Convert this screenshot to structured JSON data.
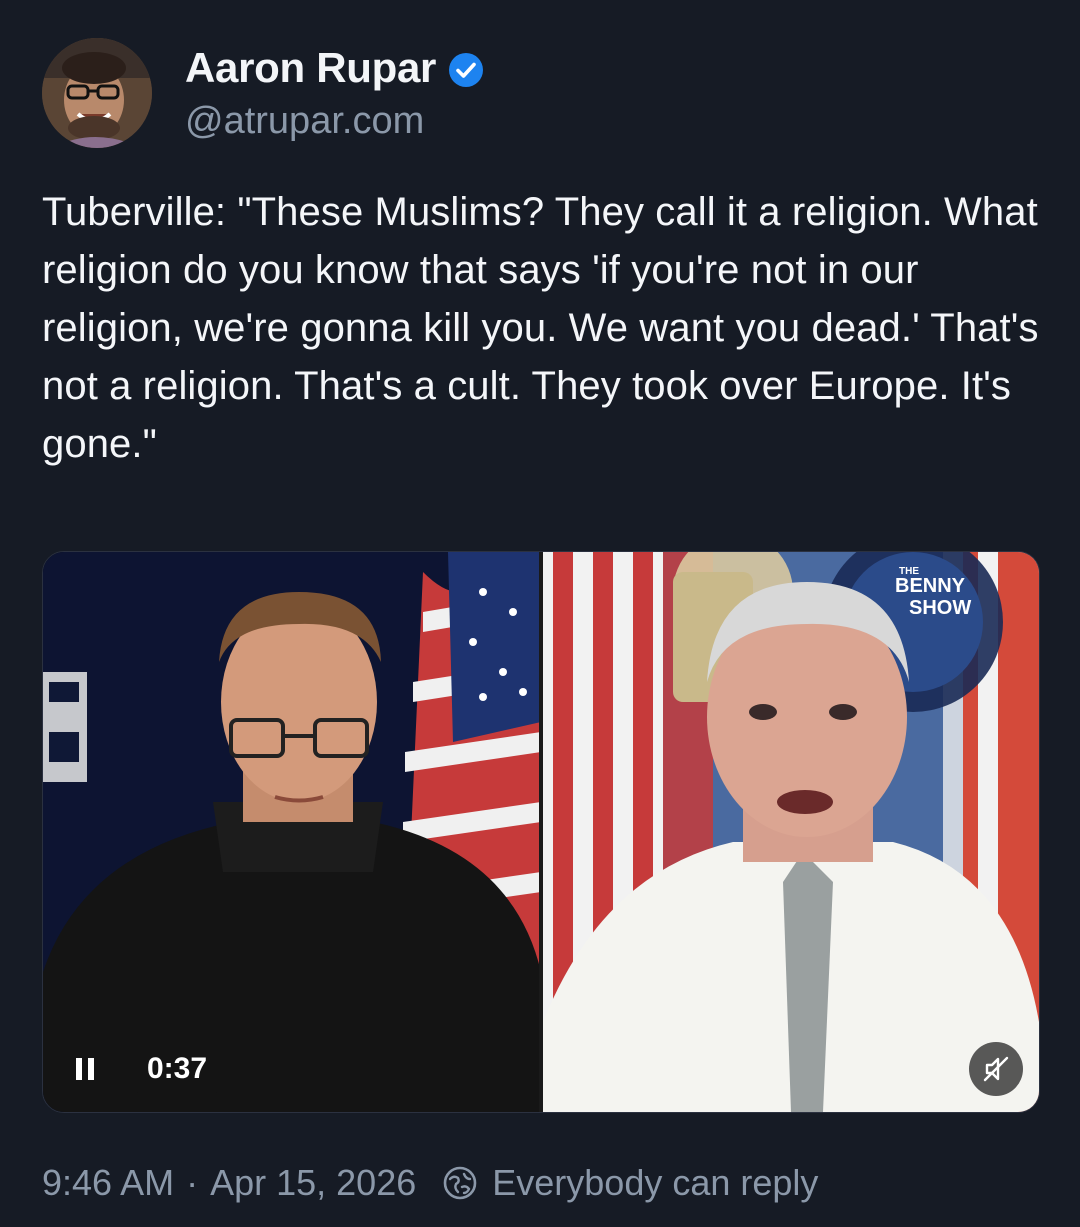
{
  "author": {
    "display_name": "Aaron Rupar",
    "handle": "@atrupar.com",
    "avatar_icon": "person-avatar",
    "verified_icon": "verified-badge-icon",
    "verified_color": "#1d83f0"
  },
  "post": {
    "text": "Tuberville: \"These Muslims? They call it a religion. What religion do you know that says 'if you're not in our religion, we're gonna kill you. We want you dead.' That's not a religion. That's a cult. They took over Europe. It's gone.\""
  },
  "video": {
    "time": "0:37",
    "pause_icon": "pause-icon",
    "mute_icon": "muted-speaker-icon",
    "watermark_line1": "BENNY",
    "watermark_line2": "SHOW",
    "watermark_small": "THE"
  },
  "footer": {
    "time": "9:46 AM",
    "separator": "·",
    "date": "Apr 15, 2026",
    "reply_setting": "Everybody can reply",
    "reply_icon": "globe-icon"
  },
  "colors": {
    "background": "#161b25",
    "text": "#f4f6f9",
    "muted": "#8b98a9"
  }
}
